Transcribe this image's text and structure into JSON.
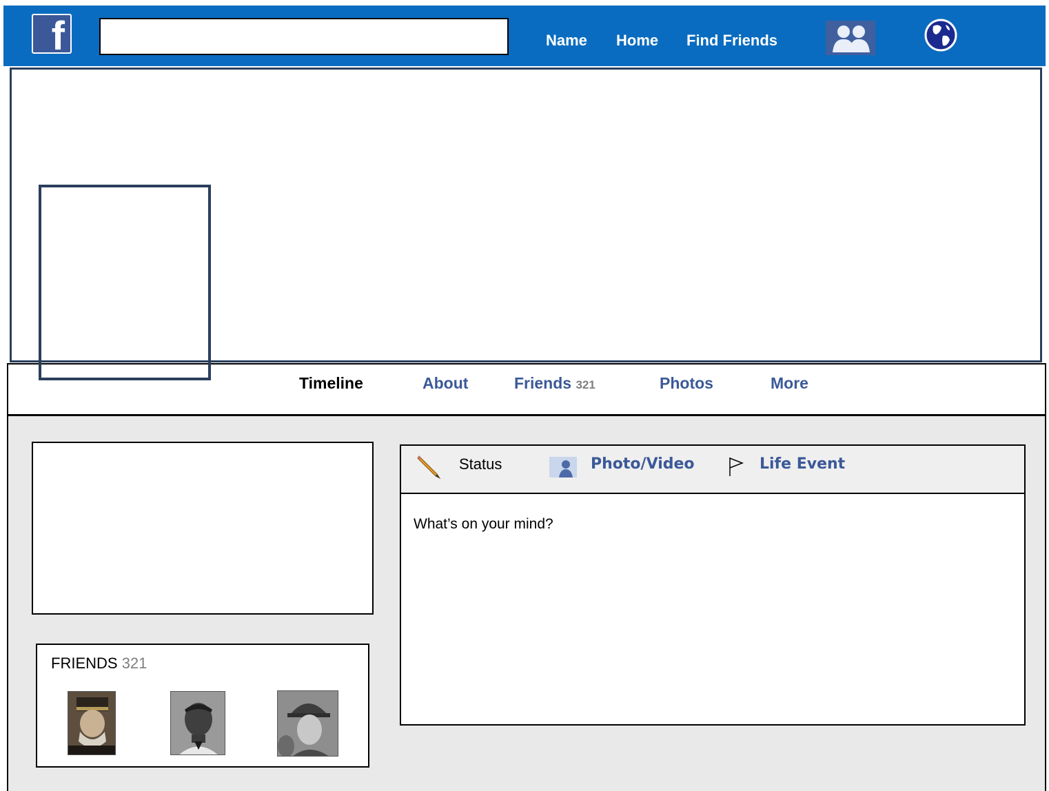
{
  "header": {
    "logo_letter": "f",
    "search": {
      "value": "",
      "placeholder": ""
    },
    "nav": [
      "Name",
      "Home",
      "Find Friends"
    ],
    "icons": [
      "facebook-logo",
      "friend-requests-icon",
      "notifications-globe-icon"
    ]
  },
  "tabs": [
    {
      "label": "Timeline",
      "active": true
    },
    {
      "label": "About"
    },
    {
      "label": "Friends",
      "count": "321"
    },
    {
      "label": "Photos"
    },
    {
      "label": "More"
    }
  ],
  "friends_panel": {
    "title": "FRIENDS",
    "count": "321"
  },
  "composer": {
    "items": [
      "Status",
      "Photo/Video",
      "Life Event"
    ],
    "prompt": "What’s on your mind?"
  },
  "colors": {
    "topbar": "#0a6cc0",
    "link": "#3b5998",
    "border": "#2a3f5c",
    "background": "#e9e9e9"
  }
}
